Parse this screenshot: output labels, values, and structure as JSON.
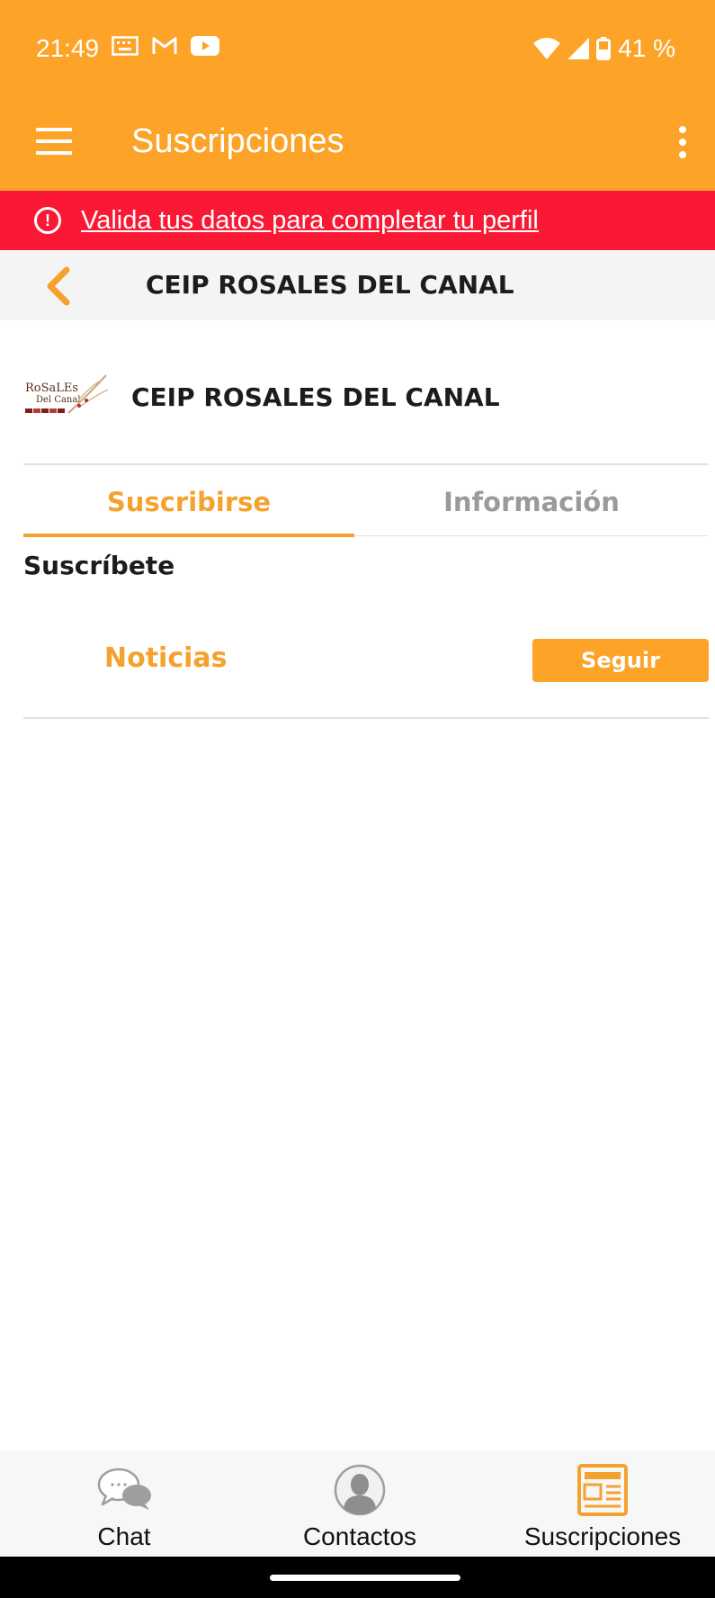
{
  "status_bar": {
    "time": "21:49",
    "battery": "41 %",
    "icons_left": [
      "keyboard-icon",
      "gmail-icon",
      "youtube-icon"
    ],
    "icons_right": [
      "wifi-icon",
      "signal-icon",
      "battery-icon"
    ]
  },
  "app_bar": {
    "title": "Suscripciones",
    "menu_icon": "hamburger-menu-icon",
    "more_icon": "more-vertical-icon"
  },
  "alert": {
    "text": "Valida tus datos para completar tu perfil",
    "icon": "alert-circle-icon",
    "color": "#fb1834"
  },
  "sub_header": {
    "title": "CEIP ROSALES DEL CANAL"
  },
  "organization": {
    "name": "CEIP ROSALES DEL CANAL",
    "logo_text_line1": "RoSaLEs",
    "logo_text_line2": "Del Canal"
  },
  "tabs": [
    {
      "label": "Suscribirse",
      "active": true
    },
    {
      "label": "Información",
      "active": false
    }
  ],
  "section": {
    "heading": "Suscríbete"
  },
  "subscriptions": [
    {
      "name": "Noticias",
      "button_label": "Seguir"
    }
  ],
  "bottom_nav": [
    {
      "label": "Chat",
      "icon": "chat-bubbles-icon"
    },
    {
      "label": "Contactos",
      "icon": "contact-avatar-icon"
    },
    {
      "label": "Suscripciones",
      "icon": "newspaper-icon",
      "active": true
    }
  ],
  "colors": {
    "brand": "#fca328",
    "accent_text": "#f4a22d",
    "inactive_tab": "#9a9a9a"
  }
}
